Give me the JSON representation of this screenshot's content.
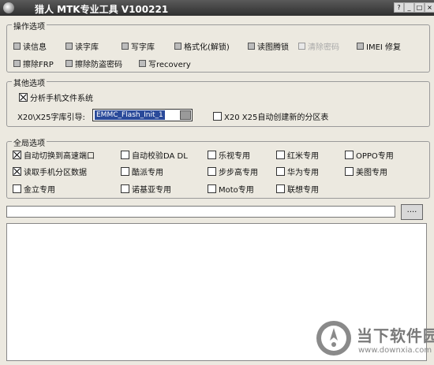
{
  "window": {
    "title": "猎人 MTK专业工具 V100221",
    "buttons": [
      "?",
      "_",
      "□",
      "×"
    ]
  },
  "ops": {
    "legend": "操作选项",
    "items": [
      {
        "label": "读信息",
        "checked": false
      },
      {
        "label": "读字库",
        "checked": false
      },
      {
        "label": "写字库",
        "checked": false
      },
      {
        "label": "格式化(解锁)",
        "checked": false
      },
      {
        "label": "读图腾锁",
        "checked": false
      },
      {
        "label": "清除密码",
        "checked": false,
        "disabled": true
      },
      {
        "label": "IMEI 修复",
        "checked": false
      },
      {
        "label": "擦除FRP",
        "checked": false
      },
      {
        "label": "擦除防盗密码",
        "checked": false
      },
      {
        "label": "写recovery",
        "checked": false
      }
    ]
  },
  "other": {
    "legend": "其他选项",
    "analyze_fs": {
      "label": "分析手机文件系统",
      "checked": true
    },
    "lib_label": "X20\\X25字库引导:",
    "lib_value": "EMMC_Flash_Init_1",
    "auto_partition": {
      "label": "X20 X25自动创建新的分区表",
      "checked": false
    }
  },
  "global": {
    "legend": "全局选项",
    "items": [
      {
        "label": "自动切换到高速端口",
        "checked": true
      },
      {
        "label": "自动校验DA DL",
        "checked": false
      },
      {
        "label": "乐视专用",
        "checked": false
      },
      {
        "label": "红米专用",
        "checked": false
      },
      {
        "label": "OPPO专用",
        "checked": false
      },
      {
        "label": "读取手机分区数据",
        "checked": true
      },
      {
        "label": "酷派专用",
        "checked": false
      },
      {
        "label": "步步高专用",
        "checked": false
      },
      {
        "label": "华为专用",
        "checked": false
      },
      {
        "label": "美图专用",
        "checked": false
      },
      {
        "label": "金立专用",
        "checked": false
      },
      {
        "label": "诺基亚专用",
        "checked": false
      },
      {
        "label": "Moto专用",
        "checked": false
      },
      {
        "label": "联想专用",
        "checked": false
      }
    ]
  },
  "browse_label": "....",
  "watermark": {
    "name": "当下软件园",
    "url": "www.downxia.com"
  }
}
